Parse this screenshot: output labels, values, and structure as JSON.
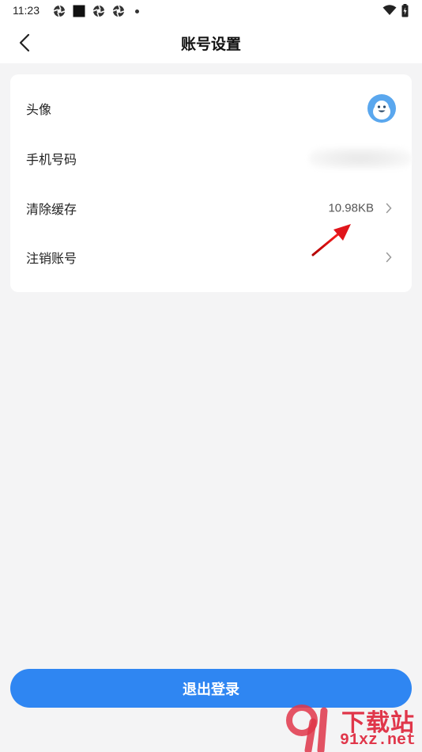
{
  "status_bar": {
    "time": "11:23",
    "icons": [
      "app-notification-icon",
      "square-notification-icon",
      "app-notification-icon",
      "app-notification-icon",
      "more-dot-icon",
      "wifi-icon",
      "battery-charging-icon"
    ]
  },
  "header": {
    "title": "账号设置",
    "back_icon": "chevron-left-icon"
  },
  "settings": {
    "items": [
      {
        "label": "头像",
        "value": "",
        "trailing": "avatar"
      },
      {
        "label": "手机号码",
        "value": "",
        "trailing": "blurred-value"
      },
      {
        "label": "清除缓存",
        "value": "10.98KB",
        "trailing": "chevron-right-icon"
      },
      {
        "label": "注销账号",
        "value": "",
        "trailing": "chevron-right-icon"
      }
    ]
  },
  "logout_button": {
    "label": "退出登录"
  },
  "watermark": {
    "brand": "下载站",
    "url": "91xz.net"
  },
  "colors": {
    "accent": "#2f86f2",
    "background": "#f4f4f5",
    "card": "#ffffff",
    "annotation_arrow": "#e0151b",
    "watermark": "#e0364a"
  }
}
